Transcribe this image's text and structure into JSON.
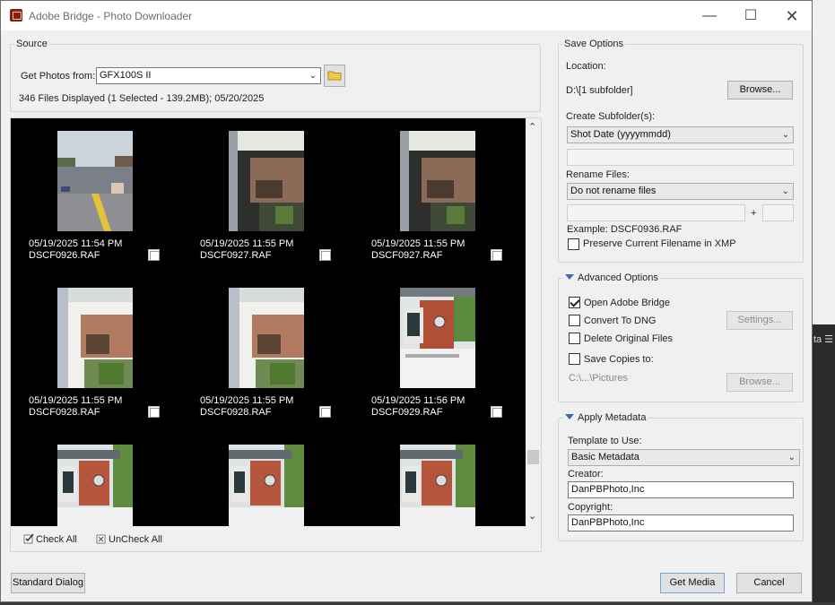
{
  "window": {
    "title": "Adobe Bridge - Photo Downloader"
  },
  "source": {
    "group_label": "Source",
    "get_photos_label": "Get Photos from:",
    "device": "GFX100S II",
    "files_info": "346 Files Displayed (1 Selected - 139.2MB); 05/20/2025"
  },
  "photos": [
    {
      "date": "05/19/2025 11:54 PM",
      "file": "DSCF0926.RAF",
      "scene": "street"
    },
    {
      "date": "05/19/2025 11:55 PM",
      "file": "DSCF0927.RAF",
      "scene": "porch-dark"
    },
    {
      "date": "05/19/2025 11:55 PM",
      "file": "DSCF0927.RAF",
      "scene": "porch-dark"
    },
    {
      "date": "05/19/2025 11:55 PM",
      "file": "DSCF0928.RAF",
      "scene": "porch-bright"
    },
    {
      "date": "05/19/2025 11:55 PM",
      "file": "DSCF0928.RAF",
      "scene": "porch-bright"
    },
    {
      "date": "05/19/2025 11:56 PM",
      "file": "DSCF0929.RAF",
      "scene": "brick"
    },
    {
      "date": "",
      "file": "",
      "scene": "shop"
    },
    {
      "date": "",
      "file": "",
      "scene": "shop"
    },
    {
      "date": "",
      "file": "",
      "scene": "shop"
    }
  ],
  "footer_links": {
    "check_all": "Check All",
    "uncheck_all": "UnCheck All"
  },
  "save_options": {
    "group_label": "Save Options",
    "location_label": "Location:",
    "location_value": "D:\\[1 subfolder]",
    "browse_label": "Browse...",
    "subfolder_label": "Create Subfolder(s):",
    "subfolder_value": "Shot Date (yyyymmdd)",
    "rename_label": "Rename Files:",
    "rename_value": "Do not rename files",
    "plus": "+",
    "example": "Example:  DSCF0936.RAF",
    "preserve_label": "Preserve Current Filename in XMP"
  },
  "advanced": {
    "group_label": "Advanced Options",
    "open_bridge": "Open Adobe Bridge",
    "convert_dng": "Convert To DNG",
    "settings_label": "Settings...",
    "delete_originals": "Delete Original Files",
    "save_copies": "Save Copies to:",
    "copies_path": "C:\\...\\Pictures",
    "browse_label": "Browse..."
  },
  "metadata": {
    "group_label": "Apply Metadata",
    "template_label": "Template to Use:",
    "template_value": "Basic Metadata",
    "creator_label": "Creator:",
    "creator_value": "DanPBPhoto,Inc",
    "copyright_label": "Copyright:",
    "copyright_value": "DanPBPhoto,Inc"
  },
  "buttons": {
    "standard_dialog": "Standard Dialog",
    "get_media": "Get Media",
    "cancel": "Cancel"
  },
  "background": {
    "fragment_text": "ta"
  }
}
